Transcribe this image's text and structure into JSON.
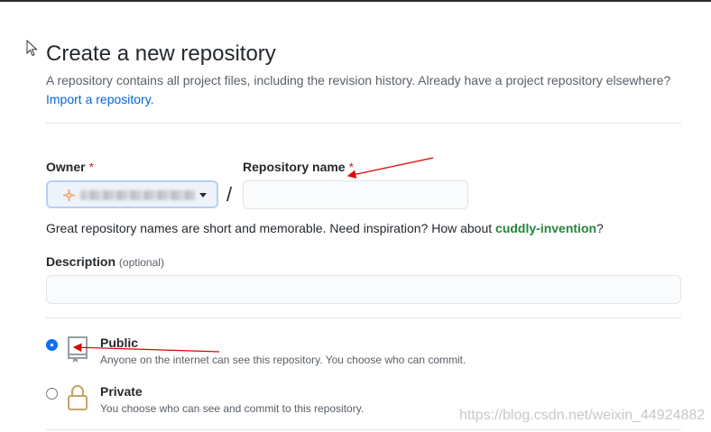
{
  "page": {
    "title": "Create a new repository",
    "subtitle": "A repository contains all project files, including the revision history. Already have a project repository elsewhere?",
    "import_link": "Import a repository."
  },
  "owner": {
    "label": "Owner",
    "required_mark": "*"
  },
  "repo_name": {
    "label": "Repository name",
    "required_mark": "*",
    "value": ""
  },
  "separator": "/",
  "hint": {
    "prefix": "Great repository names are short and memorable. Need inspiration? How about ",
    "suggestion": "cuddly-invention",
    "suffix": "?"
  },
  "description": {
    "label": "Description",
    "optional": "(optional)",
    "value": ""
  },
  "visibility": {
    "public": {
      "title": "Public",
      "desc": "Anyone on the internet can see this repository. You choose who can commit.",
      "selected": true,
      "icon": "repo-icon"
    },
    "private": {
      "title": "Private",
      "desc": "You choose who can see and commit to this repository.",
      "selected": false,
      "icon": "lock-icon"
    }
  },
  "watermark": "https://blog.csdn.net/weixin_44924882",
  "colors": {
    "link": "#0366d6",
    "required": "#cb2431",
    "suggestion": "#22863a",
    "radio_selected": "#0b6ff0",
    "annotation_arrow": "#e00000"
  }
}
